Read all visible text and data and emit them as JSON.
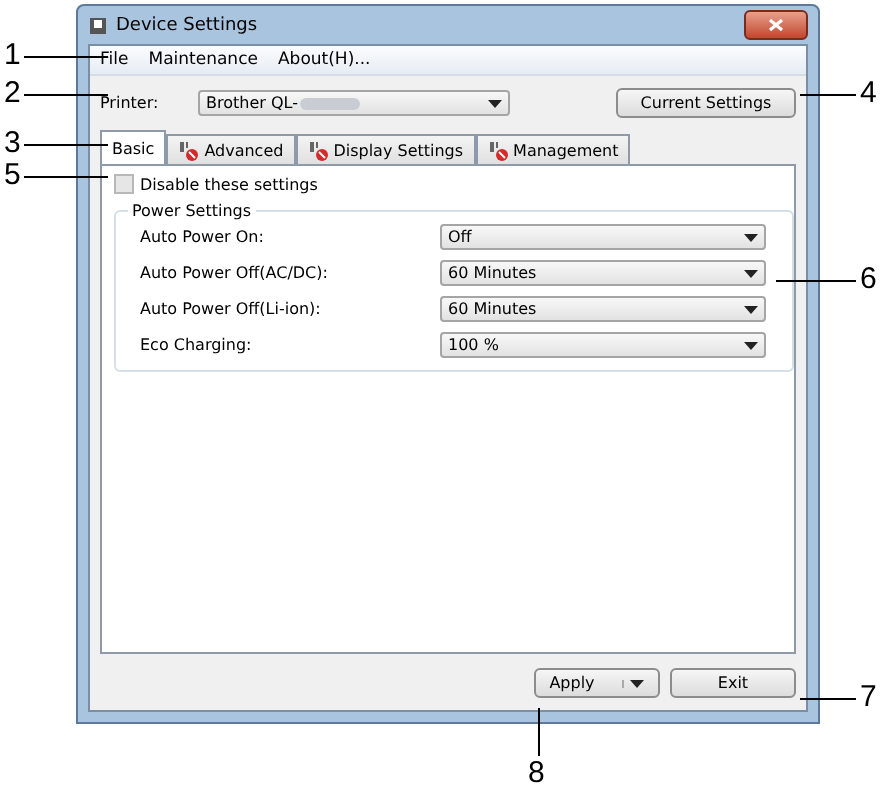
{
  "window": {
    "title": "Device Settings"
  },
  "menu": [
    "File",
    "Maintenance",
    "About(H)..."
  ],
  "printer": {
    "label": "Printer:",
    "value": "Brother QL-"
  },
  "current_settings_button": "Current Settings",
  "tabs": [
    {
      "label": "Basic",
      "selected": true,
      "restricted": false
    },
    {
      "label": "Advanced",
      "selected": false,
      "restricted": true
    },
    {
      "label": "Display Settings",
      "selected": false,
      "restricted": true
    },
    {
      "label": "Management",
      "selected": false,
      "restricted": true
    }
  ],
  "disable_checkbox": {
    "label": "Disable these settings",
    "checked": false
  },
  "group": {
    "title": "Power Settings",
    "rows": [
      {
        "label": "Auto Power On:",
        "value": "Off"
      },
      {
        "label": "Auto Power Off(AC/DC):",
        "value": "60 Minutes"
      },
      {
        "label": "Auto Power Off(Li-ion):",
        "value": "60 Minutes"
      },
      {
        "label": "Eco Charging:",
        "value": "100 %"
      }
    ]
  },
  "buttons": {
    "apply": "Apply",
    "exit": "Exit"
  },
  "callouts": [
    "1",
    "2",
    "3",
    "4",
    "5",
    "6",
    "7",
    "8"
  ]
}
